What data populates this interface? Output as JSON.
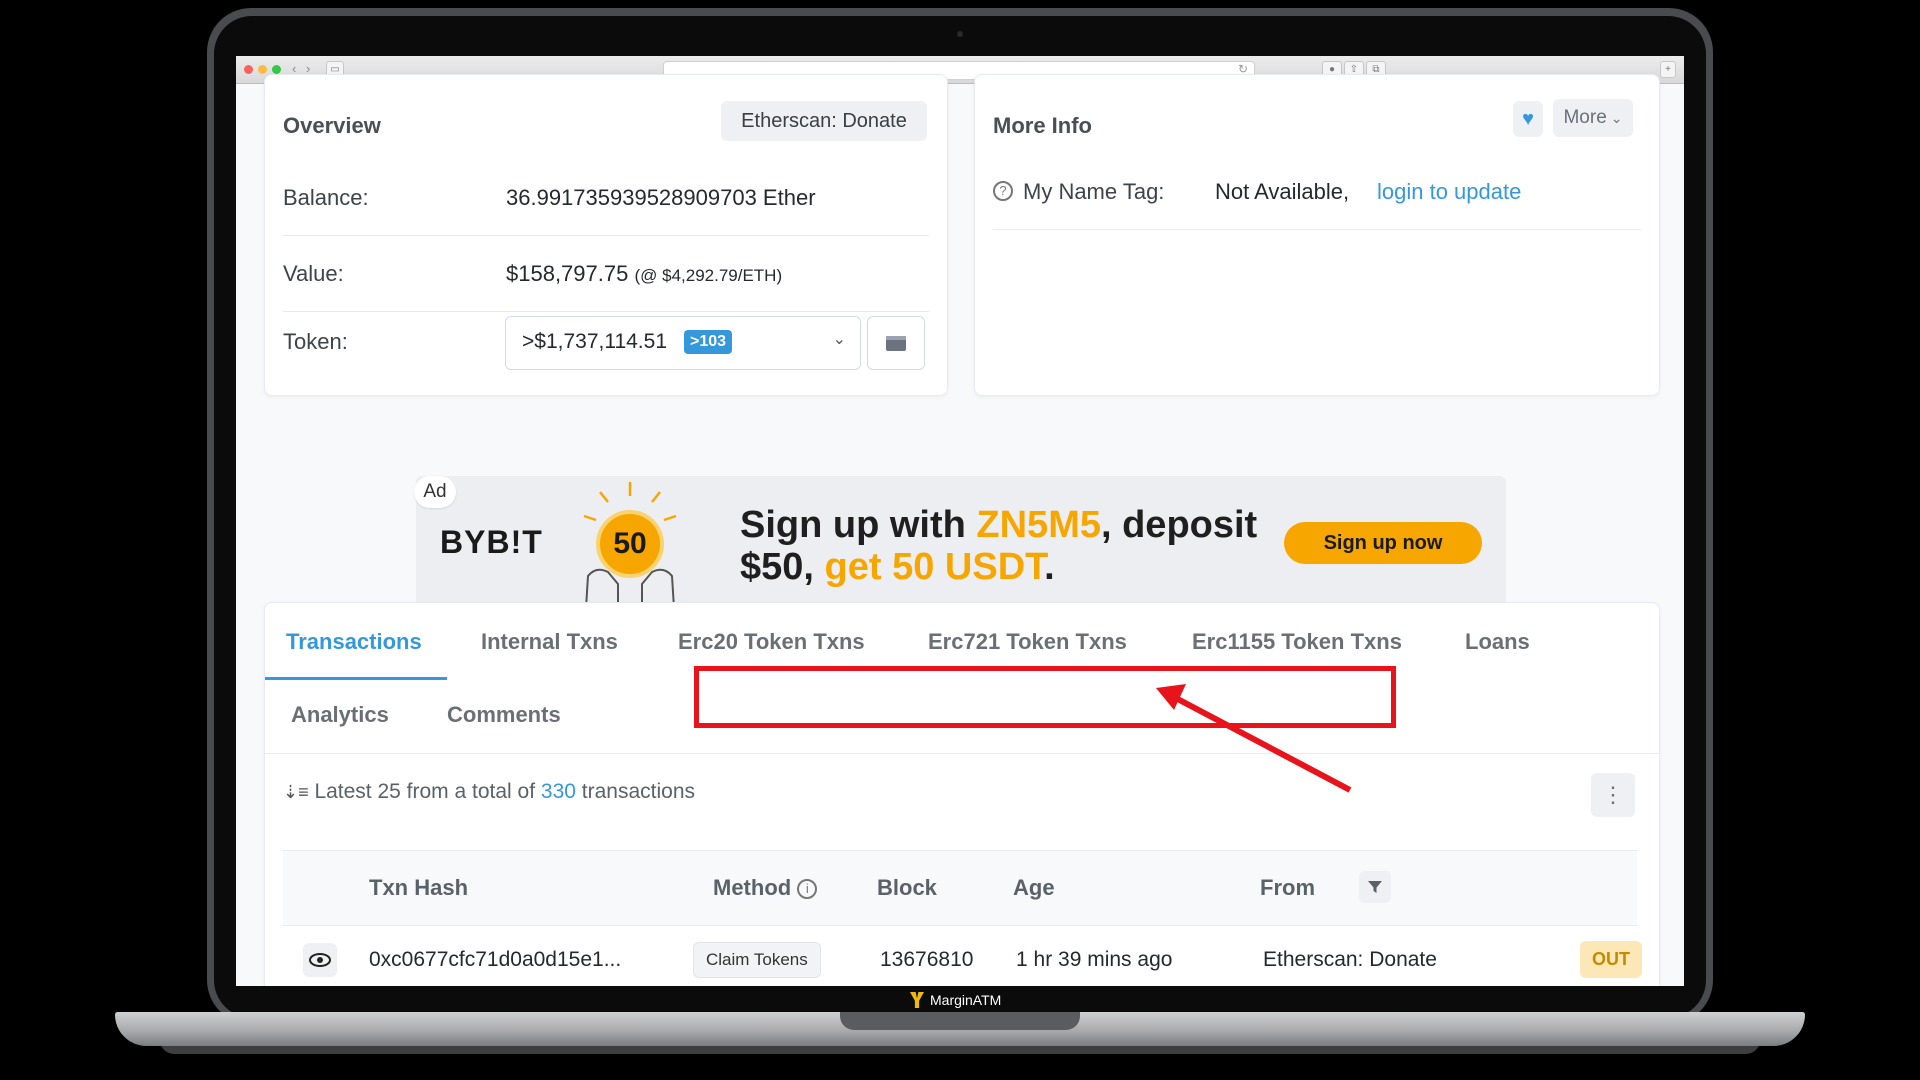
{
  "brand": {
    "name": "MarginATM"
  },
  "overview": {
    "title": "Overview",
    "donate_button": "Etherscan: Donate",
    "balance_label": "Balance:",
    "balance_value": "36.991735939528909703 Ether",
    "value_label": "Value:",
    "value_amount": "$158,797.75",
    "value_rate": "(@ $4,292.79/ETH)",
    "token_label": "Token:",
    "token_value": ">$1,737,114.51",
    "token_count": ">103"
  },
  "more_info": {
    "title": "More Info",
    "more_button": "More",
    "name_tag_label": "My Name Tag:",
    "name_tag_value": "Not Available,",
    "name_tag_link": "login to update"
  },
  "ad": {
    "tag": "Ad",
    "brand": "BYB!T",
    "coin_value": "50",
    "line1_a": "Sign up with ",
    "line1_code": "ZN5M5",
    "line1_b": ", deposit",
    "line2_a": "$50, ",
    "line2_hl": "get 50 USDT",
    "line2_b": ".",
    "cta": "Sign up now"
  },
  "tabs": {
    "items": [
      "Transactions",
      "Internal Txns",
      "Erc20 Token Txns",
      "Erc721 Token Txns",
      "Erc1155 Token Txns",
      "Loans",
      "Analytics",
      "Comments"
    ],
    "active": "Transactions"
  },
  "summary": {
    "prefix": "Latest 25 from a total of",
    "count": "330",
    "suffix": "transactions"
  },
  "table": {
    "headers": {
      "hash": "Txn Hash",
      "method": "Method",
      "block": "Block",
      "age": "Age",
      "from": "From"
    },
    "rows": [
      {
        "hash": "0xc0677cfc71d0a0d15e1...",
        "method": "Claim Tokens",
        "block": "13676810",
        "age": "1 hr 39 mins ago",
        "from": "Etherscan: Donate",
        "direction": "OUT"
      }
    ]
  },
  "colors": {
    "accent": "#3498db",
    "highlight_box": "#e8141c",
    "ad_yellow": "#f7a600"
  }
}
